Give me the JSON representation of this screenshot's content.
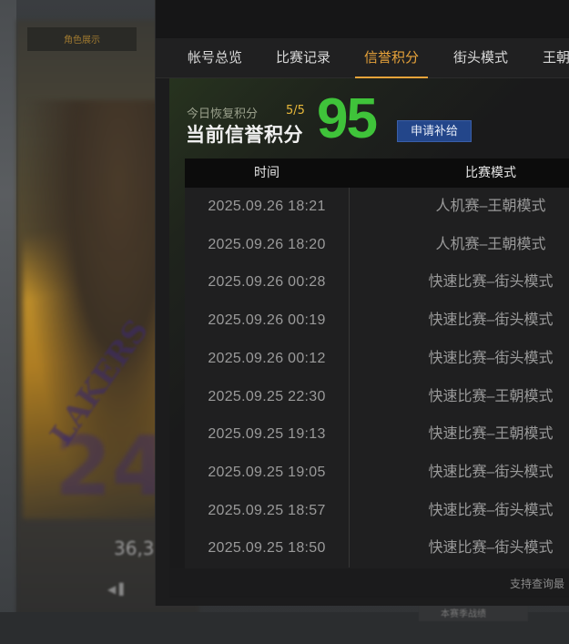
{
  "background": {
    "side_tab": "角色展示",
    "stat": "36,3",
    "bottom_button": "本赛季战绩"
  },
  "tabs": [
    {
      "label": "帐号总览",
      "active": false
    },
    {
      "label": "比赛记录",
      "active": false
    },
    {
      "label": "信誉积分",
      "active": true
    },
    {
      "label": "街头模式",
      "active": false
    },
    {
      "label": "王朝",
      "active": false
    }
  ],
  "summary": {
    "recover_label": "今日恢复积分",
    "recover_value": "5/5",
    "score_title": "当前信誉积分",
    "score_value": "95",
    "apply_button": "申请补给"
  },
  "table": {
    "headers": [
      "时间",
      "比赛模式"
    ],
    "rows": [
      {
        "time": "2025.09.26  18:21",
        "mode": "人机赛–王朝模式"
      },
      {
        "time": "2025.09.26  18:20",
        "mode": "人机赛–王朝模式"
      },
      {
        "time": "2025.09.26  00:28",
        "mode": "快速比赛–街头模式"
      },
      {
        "time": "2025.09.26  00:19",
        "mode": "快速比赛–街头模式"
      },
      {
        "time": "2025.09.26  00:12",
        "mode": "快速比赛–街头模式"
      },
      {
        "time": "2025.09.25  22:30",
        "mode": "快速比赛–王朝模式"
      },
      {
        "time": "2025.09.25  19:13",
        "mode": "快速比赛–王朝模式"
      },
      {
        "time": "2025.09.25  19:05",
        "mode": "快速比赛–街头模式"
      },
      {
        "time": "2025.09.25  18:57",
        "mode": "快速比赛–街头模式"
      },
      {
        "time": "2025.09.25  18:50",
        "mode": "快速比赛–街头模式"
      }
    ]
  },
  "footer_note": "支持查询最",
  "colors": {
    "accent": "#e8a33a",
    "score": "#3fc33a",
    "button": "#23468a",
    "recover_value": "#e8b83a"
  }
}
